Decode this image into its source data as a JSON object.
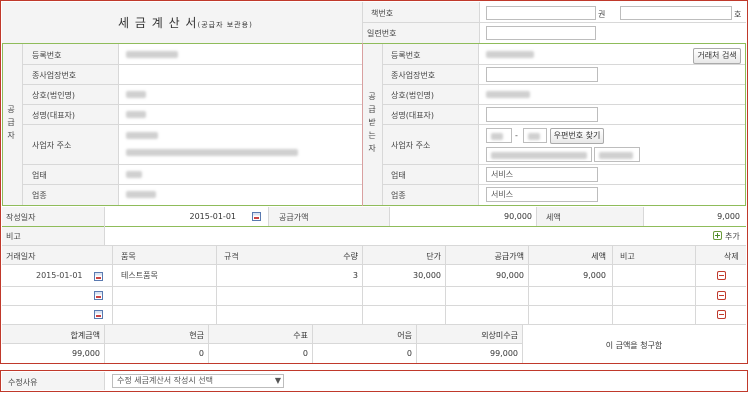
{
  "header": {
    "title": "세 금 계 산 서",
    "title_sub": "(공급자 보관용)",
    "book_no_label": "책번호",
    "book_unit_kwon": "권",
    "book_unit_ho": "호",
    "serial_label": "일련번호"
  },
  "supplier": {
    "side_label": [
      "공",
      "급",
      "자"
    ],
    "reg_no_label": "등록번호",
    "branch_label": "종사업장번호",
    "company_label": "상호(법인명)",
    "name_label": "성명(대표자)",
    "address_label": "사업자 주소",
    "business_label": "업태",
    "type_label": "업종"
  },
  "receiver": {
    "side_label": [
      "공",
      "급",
      "받",
      "는",
      "자"
    ],
    "reg_no_label": "등록번호",
    "search_button": "거래처 검색",
    "branch_label": "종사업장번호",
    "company_label": "상호(법인명)",
    "name_label": "성명(대표자)",
    "address_label": "사업자 주소",
    "zip_dash": "-",
    "zip_button": "우편번호 찾기",
    "business_label": "업태",
    "business_value": "서비스",
    "type_label": "업종",
    "type_value": "서비스"
  },
  "summary": {
    "date_label": "작성일자",
    "date_value": "2015-01-01",
    "supply_label": "공급가액",
    "supply_value": "90,000",
    "tax_label": "세액",
    "tax_value": "9,000",
    "note_label": "비고",
    "add_label": "추가"
  },
  "items": {
    "headers": [
      "거래일자",
      "품목",
      "규격",
      "수량",
      "단가",
      "공급가액",
      "세액",
      "비고",
      "삭제"
    ],
    "rows": [
      {
        "date": "2015-01-01",
        "item": "테스트품목",
        "spec": "",
        "qty": "3",
        "price": "30,000",
        "supply": "90,000",
        "tax": "9,000",
        "note": ""
      },
      {
        "date": "",
        "item": "",
        "spec": "",
        "qty": "",
        "price": "",
        "supply": "",
        "tax": "",
        "note": ""
      },
      {
        "date": "",
        "item": "",
        "spec": "",
        "qty": "",
        "price": "",
        "supply": "",
        "tax": "",
        "note": ""
      }
    ]
  },
  "totals": {
    "headers": [
      "합계금액",
      "현금",
      "수표",
      "어음",
      "외상미수금"
    ],
    "values": [
      "99,000",
      "0",
      "0",
      "0",
      "99,000"
    ],
    "claim_text": "이 금액을 청구함"
  },
  "revision": {
    "label": "수정사유",
    "select_value": "수정 세금계산서 작성시 선택"
  },
  "colors": {
    "red_border": "#c0392b",
    "green_border": "#8fbc5a",
    "gray_line": "#d8d8d8"
  }
}
